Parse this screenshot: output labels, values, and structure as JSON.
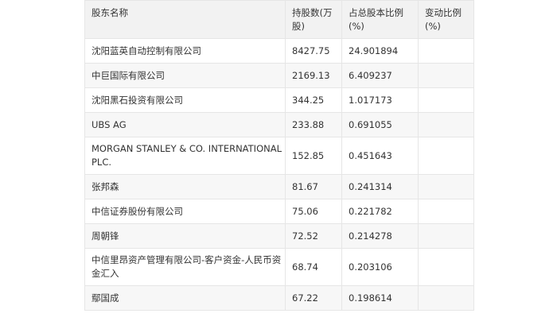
{
  "table": {
    "headers": [
      "股东名称",
      "持股数(万股)",
      "占总股本比例(%)",
      "变动比例(%)"
    ],
    "rows": [
      {
        "name": "沈阳蓝英自动控制有限公司",
        "shares": "8427.75",
        "ratio": "24.901894",
        "change": ""
      },
      {
        "name": "中巨国际有限公司",
        "shares": "2169.13",
        "ratio": "6.409237",
        "change": ""
      },
      {
        "name": "沈阳黑石投资有限公司",
        "shares": "344.25",
        "ratio": "1.017173",
        "change": ""
      },
      {
        "name": "UBS AG",
        "shares": "233.88",
        "ratio": "0.691055",
        "change": ""
      },
      {
        "name": "MORGAN STANLEY & CO. INTERNATIONAL PLC.",
        "shares": "152.85",
        "ratio": "0.451643",
        "change": ""
      },
      {
        "name": "张邦森",
        "shares": "81.67",
        "ratio": "0.241314",
        "change": ""
      },
      {
        "name": "中信证券股份有限公司",
        "shares": "75.06",
        "ratio": "0.221782",
        "change": ""
      },
      {
        "name": "周朝锋",
        "shares": "72.52",
        "ratio": "0.214278",
        "change": ""
      },
      {
        "name": "中信里昂资产管理有限公司-客户资金-人民币资金汇入",
        "shares": "68.74",
        "ratio": "0.203106",
        "change": ""
      },
      {
        "name": "鄢国成",
        "shares": "67.22",
        "ratio": "0.198614",
        "change": ""
      }
    ]
  }
}
